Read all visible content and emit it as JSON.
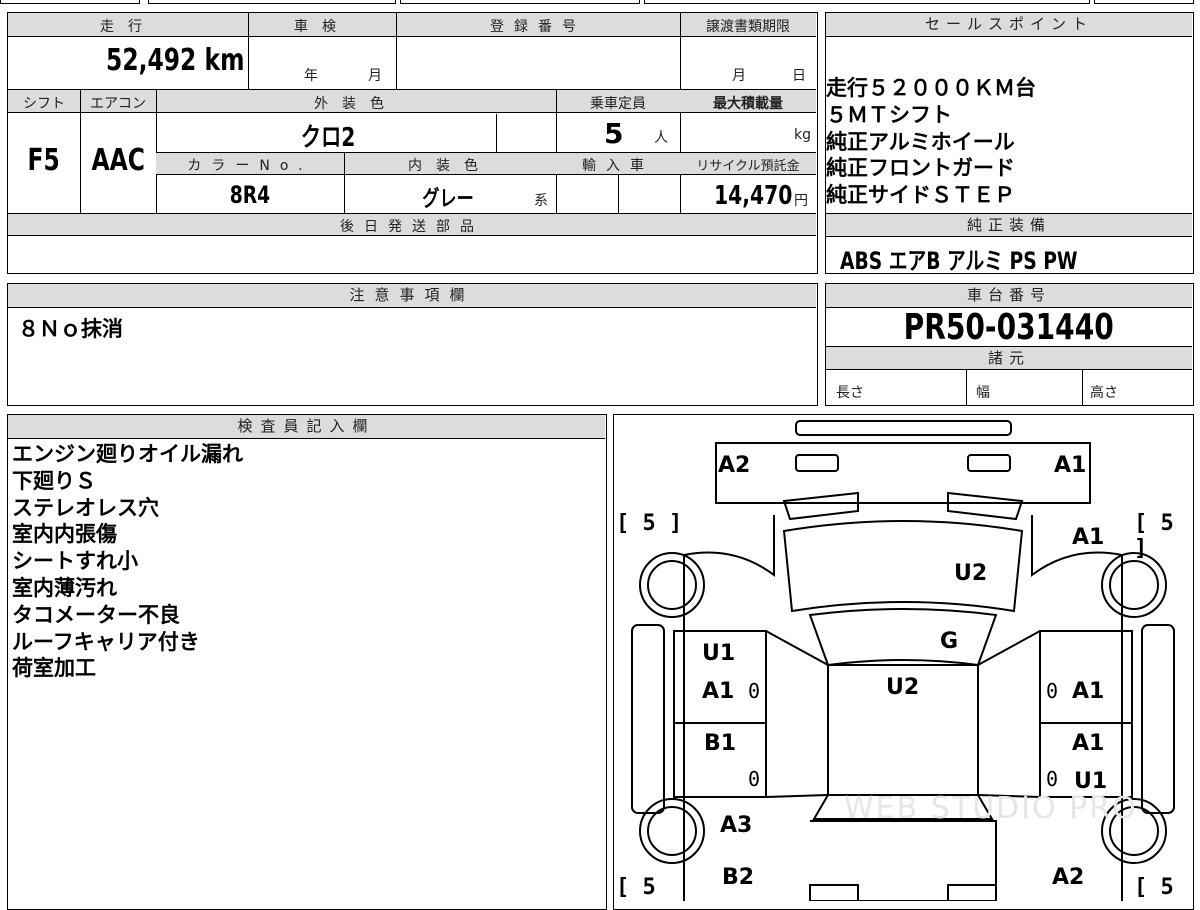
{
  "vehicle_info": {
    "mileage_label": "走行",
    "mileage_value": "52,492",
    "mileage_unit": "km",
    "shaken_label": "車検",
    "shaken_year_unit": "年",
    "shaken_month_unit": "月",
    "registration_label": "登録番号",
    "transfer_deadline_label": "譲渡書類期限",
    "transfer_month_unit": "月",
    "transfer_day_unit": "日",
    "shift_label": "シフト",
    "shift_value": "F5",
    "aircon_label": "エアコン",
    "aircon_value": "AAC",
    "exterior_color_label": "外装色",
    "exterior_color_value": "クロ2",
    "capacity_label": "乗車定員",
    "capacity_value": "5",
    "capacity_unit": "人",
    "max_load_label": "最大積載量",
    "max_load_unit": "kg",
    "color_no_label": "カラーNo.",
    "color_no_value": "8R4",
    "interior_color_label": "内装色",
    "interior_color_value": "グレー",
    "interior_color_suffix": "系",
    "import_label": "輸入車",
    "recycle_label": "リサイクル預託金",
    "recycle_value": "14,470",
    "recycle_unit": "円",
    "later_parts_label": "後日発送部品"
  },
  "sales_points": {
    "header": "セールスポイント",
    "lines": [
      "走行５２０００ＫＭ台",
      "５ＭＴシフト",
      "純正アルミホイール",
      "純正フロントガード",
      "純正サイドＳＴＥＰ"
    ]
  },
  "equipment": {
    "header": "純正装備",
    "value": "ABS エアB アルミ PS PW"
  },
  "caution": {
    "header": "注意事項欄",
    "text": "８Ｎｏ抹消"
  },
  "chassis": {
    "header": "車台番号",
    "value": "PR50-031440",
    "specs_header": "諸元",
    "length_label": "長さ",
    "width_label": "幅",
    "height_label": "高さ"
  },
  "inspector": {
    "header": "検査員記入欄",
    "lines": [
      "エンジン廻りオイル漏れ",
      "下廻りＳ",
      "ステレオレス穴",
      "室内内張傷",
      "シートすれ小",
      "室内薄汚れ",
      "タコメーター不良",
      "ルーフキャリア付き",
      "荷室加工"
    ]
  },
  "diagram": {
    "tags": {
      "front_left": "A2",
      "front_right": "A1",
      "hood": "U2",
      "windshield": "G",
      "roof": "U2",
      "left_front_door_1": "U1",
      "left_front_door_2": "A1",
      "left_rear_door": "B1",
      "right_fender": "A1",
      "right_front_door": "A1",
      "right_rear_door_1": "A1",
      "right_rear_door_2": "U1",
      "left_quarter": "A3",
      "left_rear": "B2",
      "right_rear": "A2"
    },
    "tire_left_front": "[ 5 ]",
    "tire_right_front": "[ 5 ]",
    "tire_left_rear": "[ 5",
    "tire_right_rear": "[ 5",
    "zero_marks": [
      "0",
      "0",
      "0",
      "0"
    ],
    "watermark": "WEB STUDIO PRO"
  }
}
